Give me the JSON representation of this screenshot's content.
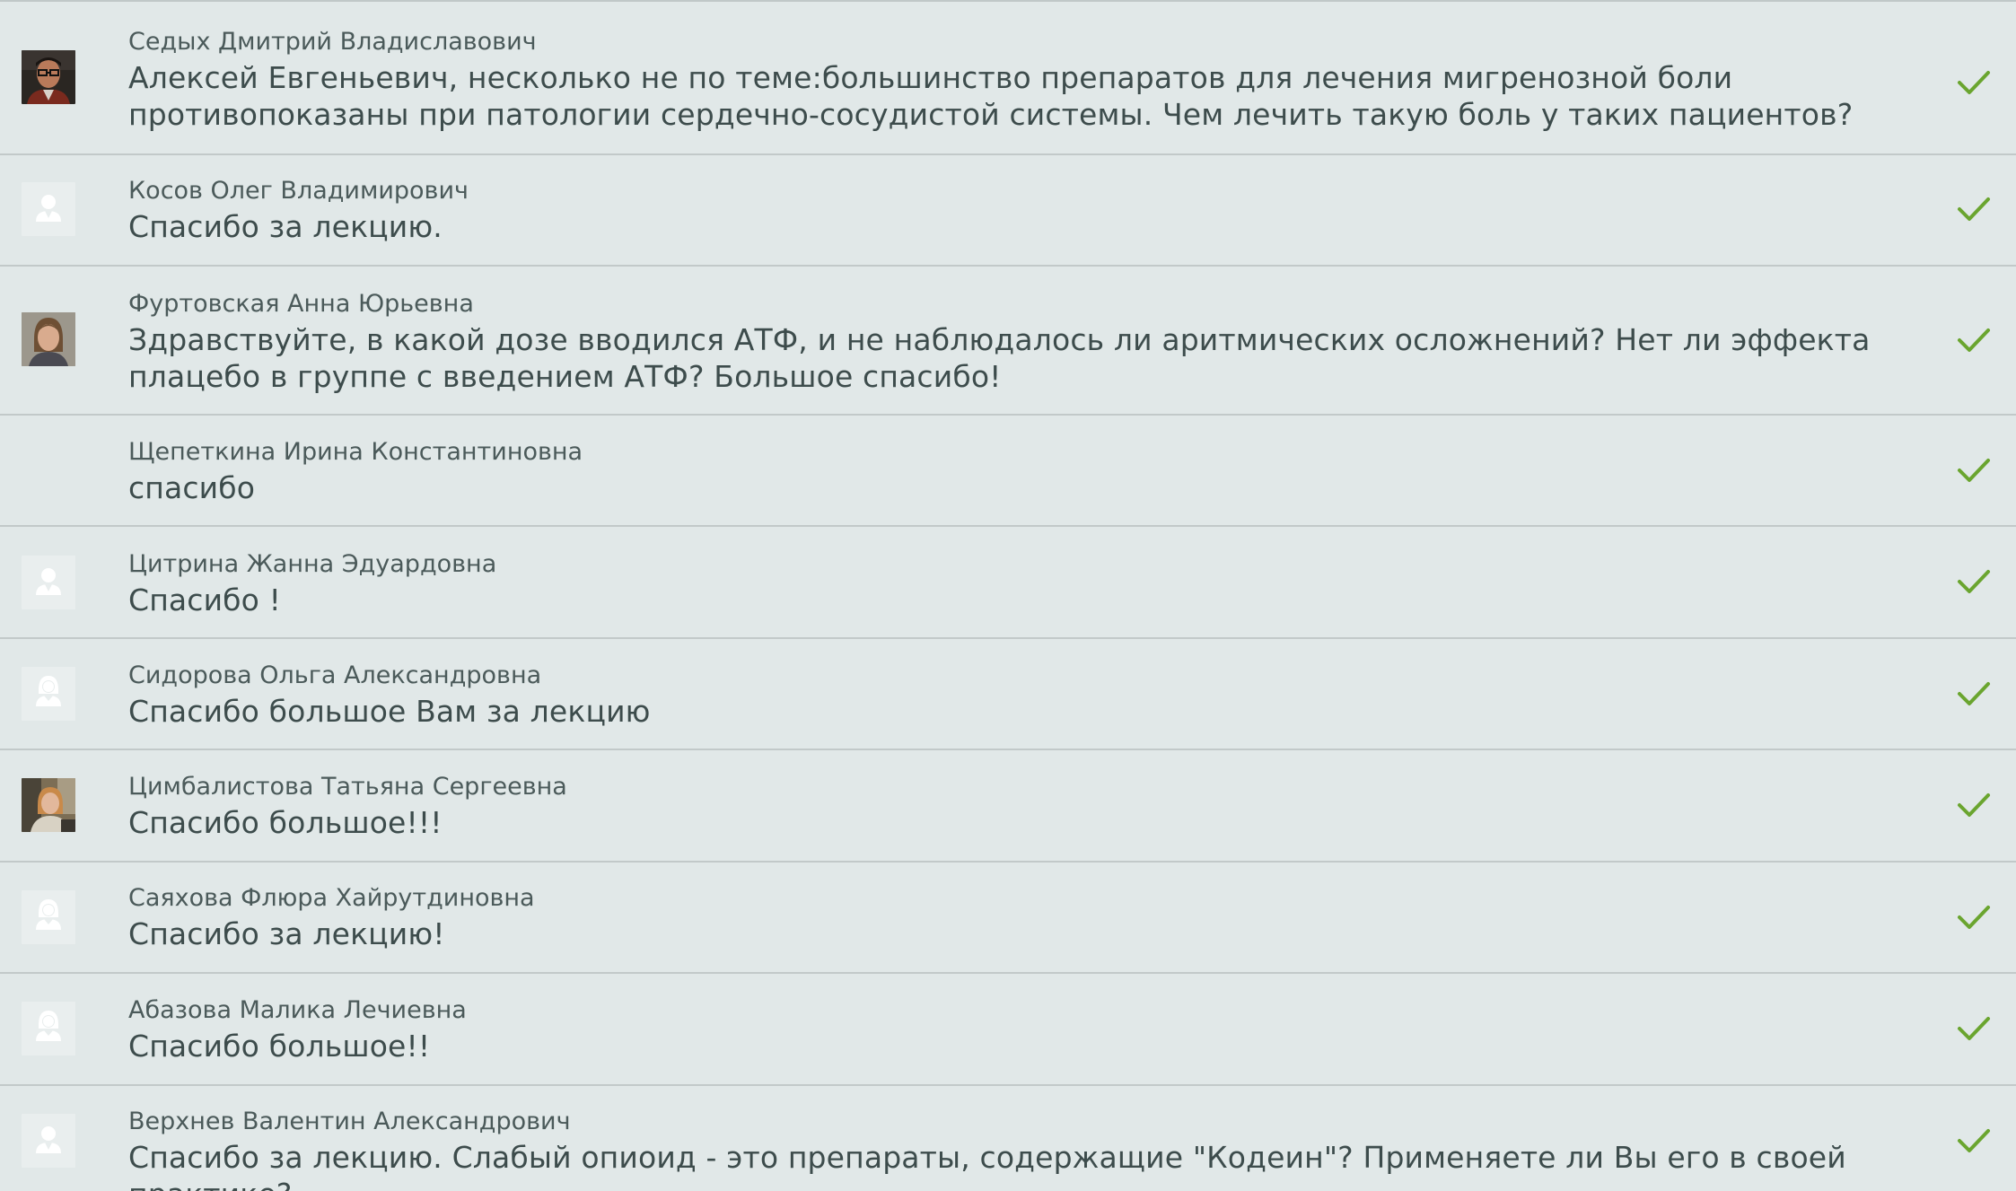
{
  "messages": [
    {
      "author": "Седых Дмитрий Владиславович",
      "text": "Алексей Евгеньевич, несколько не по теме:большинство препаратов для лечения мигренозной боли противопоказаны при патологии сердечно-сосудистой системы. Чем лечить такую боль у таких пациентов?",
      "avatar": "photo-man-glasses",
      "status": "check-icon"
    },
    {
      "author": "Косов Олег Владимирович",
      "text": "Спасибо за лекцию.",
      "avatar": "default-male-avatar",
      "status": "check-icon"
    },
    {
      "author": "Фуртовская Анна Юрьевна",
      "text": "Здравствуйте, в какой дозе вводился АТФ, и не наблюдалось ли аритмических осложнений? Нет ли эффекта плацебо в группе с введением АТФ? Большое спасибо!",
      "avatar": "photo-woman",
      "status": "check-icon"
    },
    {
      "author": "Щепеткина Ирина Константиновна",
      "text": "спасибо",
      "avatar": "none",
      "status": "check-icon"
    },
    {
      "author": "Цитрина Жанна Эдуардовна",
      "text": "Спасибо !",
      "avatar": "default-male-avatar",
      "status": "check-icon"
    },
    {
      "author": "Сидорова Ольга Александровна",
      "text": "Спасибо большое Вам за лекцию",
      "avatar": "default-female-avatar",
      "status": "check-icon"
    },
    {
      "author": "Цимбалистова Татьяна Сергеевна",
      "text": "Спасибо большое!!!",
      "avatar": "photo-woman-office",
      "status": "check-icon"
    },
    {
      "author": "Саяхова Флюра Хайрутдиновна",
      "text": "Спасибо за лекцию!",
      "avatar": "default-female-avatar",
      "status": "check-icon"
    },
    {
      "author": "Абазова Малика Лечиевна",
      "text": "Спасибо большое!!",
      "avatar": "default-female-avatar",
      "status": "check-icon"
    },
    {
      "author": "Верхнев Валентин Александрович",
      "text": "Спасибо за лекцию. Слабый опиоид - это препараты, содержащие \"Кодеин\"? Применяете ли Вы его в своей практике?",
      "avatar": "default-male-avatar",
      "status": "check-icon"
    }
  ],
  "colors": {
    "background": "#e1e8e8",
    "divider": "#c2c9c9",
    "author_text": "#4b5a5a",
    "message_text": "#3d4c4c",
    "check": "#6aa52f"
  }
}
